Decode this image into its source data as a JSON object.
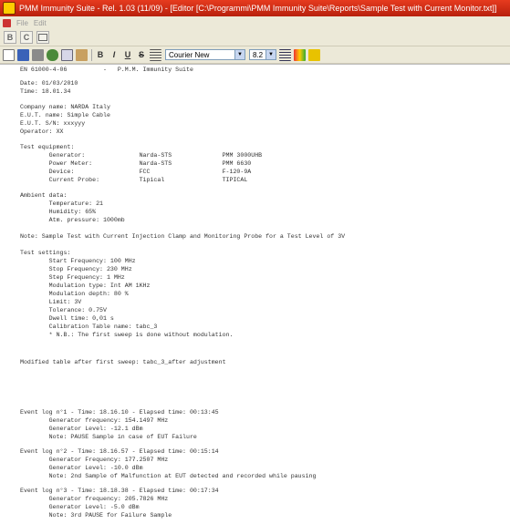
{
  "window": {
    "title": "PMM Immunity Suite - Rel. 1.03 (11/09) - [Editor [C:\\Programmi\\PMM Immunity Suite\\Reports\\Sample Test with Current Monitor.txt]]"
  },
  "menu": {
    "file": "File",
    "edit": "Edit"
  },
  "toolbar1": {
    "btn1": "B",
    "btn2": "C",
    "btn3": ""
  },
  "toolbar2": {
    "bold": "B",
    "italic": "I",
    "underline": "U",
    "strike": "S",
    "font": "Courier New",
    "size": "8.2"
  },
  "document": {
    "lines": [
      "EN 61000-4-06          -   P.M.M. Immunity Suite",
      "Date: 01/03/2010",
      "Time: 18.01.34",
      "Company name: NARDA Italy",
      "E.U.T. name: Simple Cable",
      "E.U.T. S/N: xxxyyy",
      "Operator: XX",
      "Test equipment:",
      "        Generator:               Narda-STS              PMM 3000UHB",
      "        Power Meter:             Narda-STS              PMM 6630",
      "        Device:                  FCC                    F-120-9A",
      "        Current Probe:           Tipical                TIPICAL",
      "Ambient data:",
      "        Temperature: 21",
      "        Humidity: 65%",
      "        Atm. pressure: 1000mb",
      "Note: Sample Test with Current Injection Clamp and Monitoring Probe for a Test Level of 3V",
      "Test settings:",
      "        Start Frequency: 100 MHz",
      "        Stop Frequency: 230 MHz",
      "        Step Frequency: 1 MHz",
      "        Modulation type: Int AM 1KHz",
      "        Modulation depth: 80 %",
      "        Limit: 3V",
      "        Tolerance: 0.75V",
      "        Dwell time: 0,01 s",
      "        Calibration Table name: tabc_3",
      "        * N.B.: The first sweep is done without modulation.",
      "Modified table after first sweep: tabc_3_after adjustment",
      "Event log n°1 - Time: 18.16.10 - Elapsed time: 00:13:45",
      "        Generator frequency: 154.1497 MHz",
      "        Generator Level: -12.1 dBm",
      "        Note: PAUSE Sample in case of EUT Failure",
      "Event log n°2 - Time: 18.16.57 - Elapsed time: 00:15:14",
      "        Generator Frequency: 177.2507 MHz",
      "        Generator Level: -10.0 dBm",
      "        Note: 2nd Sample of Malfunction at EUT detected and recorded while pausing",
      "Event log n°3 - Time: 18.18.38 - Elapsed time: 00:17:34",
      "        Generator frequency: 205.7826 MHz",
      "        Generator Level: -5.0 dBm",
      "        Note: 3rd PAUSE for Failure Sample"
    ]
  }
}
